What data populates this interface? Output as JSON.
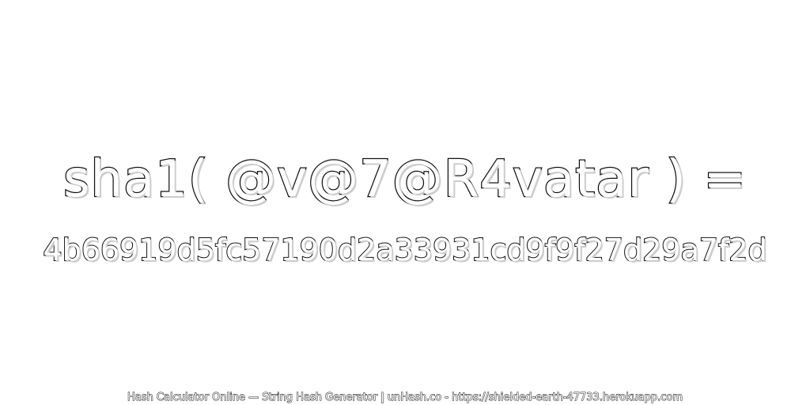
{
  "expression": "sha1( @v@7@R4vatar ) =",
  "hash": "4b66919d5fc57190d2a33931cd9f9f27d29a7f2d",
  "footer": "Hash Calculator Online — String Hash Generator | unHash.co - https://shielded-earth-47733.herokuapp.com",
  "colors": {
    "background": "#ffffff",
    "outline": "#111111",
    "fill": "#ffffff"
  }
}
